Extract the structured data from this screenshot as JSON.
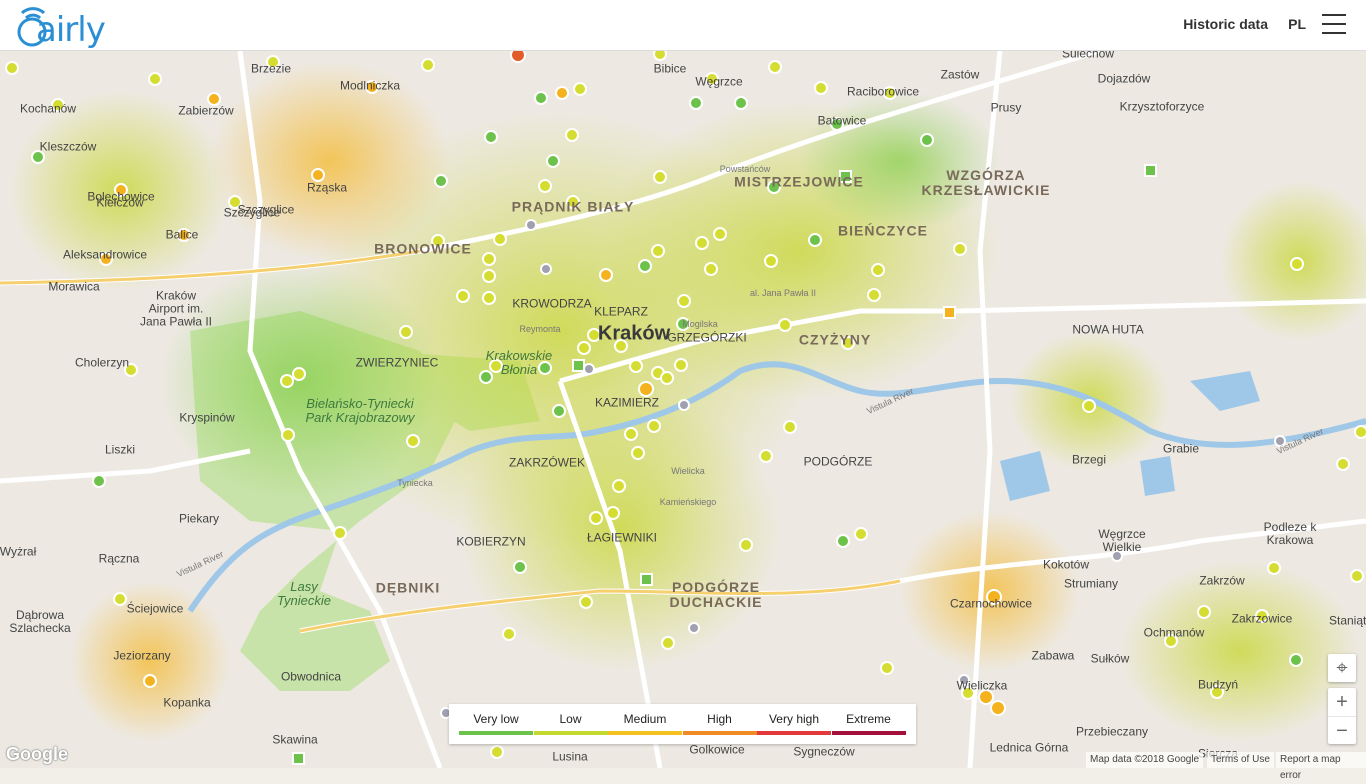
{
  "header": {
    "logo": "airly",
    "historic": "Historic data",
    "lang": "PL",
    "menu_icon": "hamburger-menu-icon"
  },
  "legend": [
    {
      "label": "Very low",
      "color": "#6cc24a"
    },
    {
      "label": "Low",
      "color": "#c5d82f"
    },
    {
      "label": "Medium",
      "color": "#f5c11f"
    },
    {
      "label": "High",
      "color": "#f08a24"
    },
    {
      "label": "Very high",
      "color": "#e23a3a"
    },
    {
      "label": "Extreme",
      "color": "#a3113a"
    }
  ],
  "map": {
    "city": "Kraków",
    "places": [
      {
        "t": "Brzezie"
      },
      {
        "t": "Zabierzów"
      },
      {
        "t": "Kleszczów"
      },
      {
        "t": "Bolechowice"
      },
      {
        "t": "Rząska"
      },
      {
        "t": "Szczyglice"
      },
      {
        "t": "Balice"
      },
      {
        "t": "Aleksandrowice"
      },
      {
        "t": "Morawica"
      },
      {
        "t": "Kraków\nAirport im.\nJana Pawła II"
      },
      {
        "t": "Cholerzyn"
      },
      {
        "t": "Kryspinów"
      },
      {
        "t": "Liszki"
      },
      {
        "t": "Piekary"
      },
      {
        "t": "Rączna"
      },
      {
        "t": "Ściejowice"
      },
      {
        "t": "Dąbrowa\nSzlachecka"
      },
      {
        "t": "Jeziorzany"
      },
      {
        "t": "Kopanka"
      },
      {
        "t": "Skawina"
      },
      {
        "t": "Kochanów"
      },
      {
        "t": "Modlniczka"
      },
      {
        "t": "Bibice"
      },
      {
        "t": "Węgrzce"
      },
      {
        "t": "Raciborowice"
      },
      {
        "t": "Batowice"
      },
      {
        "t": "Zastów"
      },
      {
        "t": "Sulechów"
      },
      {
        "t": "Dojazdów"
      },
      {
        "t": "Prusy"
      },
      {
        "t": "Krzysztoforzyce"
      },
      {
        "t": "KROWODRZA"
      },
      {
        "t": "KLEPARZ"
      },
      {
        "t": "GRZEGÓRZKI"
      },
      {
        "t": "KAZIMIERZ"
      },
      {
        "t": "ZAKRZÓWEK"
      },
      {
        "t": "ZWIERZYNIEC"
      },
      {
        "t": "PODGÓRZE"
      },
      {
        "t": "ŁAGIEWNIKI"
      },
      {
        "t": "KOBIERZYN"
      },
      {
        "t": "NOWA HUTA"
      },
      {
        "t": "Brzegi"
      },
      {
        "t": "Grabie"
      },
      {
        "t": "Węgrzce\nWielkie"
      },
      {
        "t": "Kokotów"
      },
      {
        "t": "Strumiany"
      },
      {
        "t": "Czarnochowice"
      },
      {
        "t": "Podleze k\nKrakowa"
      },
      {
        "t": "Zakrzów"
      },
      {
        "t": "Ochmanów"
      },
      {
        "t": "Zabawa"
      },
      {
        "t": "Sułków"
      },
      {
        "t": "Wieliczka"
      },
      {
        "t": "Przebieczany"
      },
      {
        "t": "Lednica Górna"
      },
      {
        "t": "Siercza"
      },
      {
        "t": "Sygneczów"
      },
      {
        "t": "Golkowice"
      },
      {
        "t": "Lusina"
      },
      {
        "t": "Obwodnica"
      },
      {
        "t": "Wyżrał"
      },
      {
        "t": "Szczyglice"
      },
      {
        "t": "Budzyń"
      },
      {
        "t": "Zakrzowice"
      },
      {
        "t": "Staniątki"
      },
      {
        "t": "Kiełczów"
      }
    ],
    "districts": [
      {
        "t": "PRĄDNIK BIAŁY"
      },
      {
        "t": "BRONOWICE"
      },
      {
        "t": "MISTRZEJOWICE"
      },
      {
        "t": "WZGÓRZA\nKRZESŁAWICKIE"
      },
      {
        "t": "BIEŃCZYCE"
      },
      {
        "t": "DĘBNIKI"
      },
      {
        "t": "PODGÓRZE\nDUCHACKIE"
      },
      {
        "t": "CZYŻYNY"
      }
    ],
    "parks": [
      {
        "t": "Bielańsko-Tyniecki\nPark Krajobrazowy"
      },
      {
        "t": "Lasy\nTynieckie"
      },
      {
        "t": "Krakowskie\nBłonia"
      }
    ],
    "rivers": [
      {
        "t": "Vistula River"
      },
      {
        "t": "Vistula River"
      },
      {
        "t": "Vistula River"
      }
    ],
    "streets": [
      {
        "t": "al. Jana Pawła II"
      },
      {
        "t": "Reymonta"
      },
      {
        "t": "Kamieńskiego"
      },
      {
        "t": "Wielicka"
      },
      {
        "t": "Tyniecka"
      },
      {
        "t": "Powstańców"
      },
      {
        "t": "Mogilska"
      }
    ]
  },
  "controls": {
    "locate": "⌖",
    "zoom_in": "+",
    "zoom_out": "−"
  },
  "attribution": {
    "google": "Google",
    "data": "Map data ©2018 Google",
    "terms": "Terms of Use",
    "report": "Report a map error"
  }
}
